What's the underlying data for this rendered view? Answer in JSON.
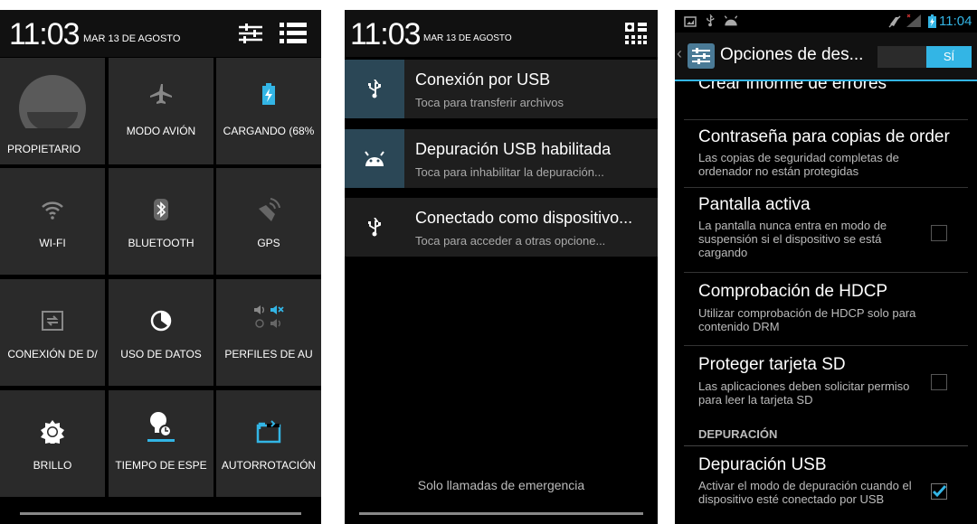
{
  "panel1": {
    "time": "11:03",
    "date": "MAR 13 DE AGOSTO",
    "tiles": [
      {
        "label": "PROPIETARIO",
        "icon": "avatar-icon"
      },
      {
        "label": "MODO AVIÓN",
        "icon": "airplane-icon"
      },
      {
        "label": "CARGANDO (68%",
        "icon": "battery-charging-icon"
      },
      {
        "label": "WI-FI",
        "icon": "wifi-icon"
      },
      {
        "label": "BLUETOOTH",
        "icon": "bluetooth-icon"
      },
      {
        "label": "GPS",
        "icon": "gps-icon"
      },
      {
        "label": "CONEXIÓN DE D/",
        "icon": "tethering-icon"
      },
      {
        "label": "USO DE DATOS",
        "icon": "data-usage-icon"
      },
      {
        "label": "PERFILES DE AU",
        "icon": "audio-profiles-icon"
      },
      {
        "label": "BRILLO",
        "icon": "brightness-icon"
      },
      {
        "label": "TIEMPO DE ESPE",
        "icon": "screen-timeout-icon"
      },
      {
        "label": "AUTORROTACIÓN",
        "icon": "auto-rotate-icon"
      }
    ]
  },
  "panel2": {
    "time": "11:03",
    "date": "MAR 13 DE AGOSTO",
    "notifications": [
      {
        "title": "Conexión por USB",
        "subtitle": "Toca para transferir archivos",
        "icon": "usb-icon"
      },
      {
        "title": "Depuración USB habilitada",
        "subtitle": "Toca para inhabilitar la depuración...",
        "icon": "android-debug-icon"
      },
      {
        "title": "Conectado como dispositivo...",
        "subtitle": "Toca para acceder a otras opcione...",
        "icon": "usb-icon"
      }
    ],
    "emergency": "Solo llamadas de emergencia"
  },
  "panel3": {
    "status_time": "11:04",
    "title": "Opciones de des...",
    "toggle_label": "SÍ",
    "partial_item": "Crear informe de errores",
    "settings": [
      {
        "title": "Contraseña para copias de order",
        "desc": "Las copias de seguridad completas de ordenador no están protegidas"
      },
      {
        "title": "Pantalla activa",
        "desc": "La pantalla nunca entra en modo de suspensión si el dispositivo se está cargando",
        "checked": false
      },
      {
        "title": "Comprobación de HDCP",
        "desc": "Utilizar comprobación de HDCP solo para contenido DRM"
      },
      {
        "title": "Proteger tarjeta SD",
        "desc": "Las aplicaciones deben solicitar permiso para leer la tarjeta SD",
        "checked": false
      }
    ],
    "section": "DEPURACIÓN",
    "usb_debug": {
      "title": "Depuración USB",
      "desc": "Activar el modo de depuración cuando el dispositivo esté conectado por USB",
      "checked": true
    }
  },
  "colors": {
    "accent": "#33b5e5",
    "tile": "#2a2a2a",
    "notif_icon_bg": "#2b4756"
  }
}
